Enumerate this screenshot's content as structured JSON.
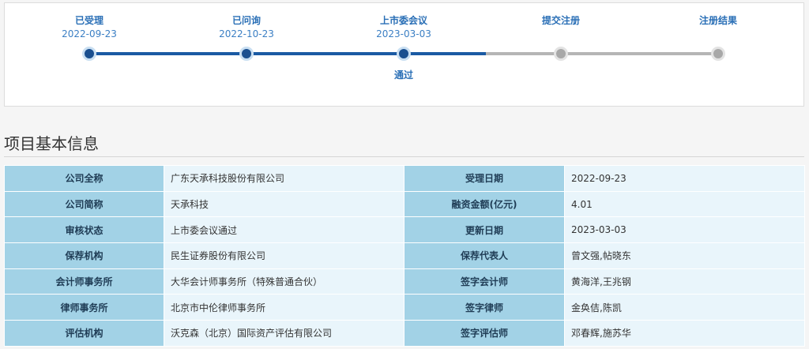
{
  "progress": {
    "steps": [
      {
        "label": "已受理",
        "date": "2022-09-23",
        "status": "done"
      },
      {
        "label": "已问询",
        "date": "2022-10-23",
        "status": "done"
      },
      {
        "label": "上市委会议",
        "date": "2023-03-03",
        "status": "done",
        "sub": "通过"
      },
      {
        "label": "提交注册",
        "date": "",
        "status": "pending"
      },
      {
        "label": "注册结果",
        "date": "",
        "status": "pending"
      }
    ]
  },
  "section": {
    "title": "项目基本信息"
  },
  "info_table": {
    "rows": [
      {
        "k1": "公司全称",
        "v1": "广东天承科技股份有限公司",
        "k2": "受理日期",
        "v2": "2022-09-23"
      },
      {
        "k1": "公司简称",
        "v1": "天承科技",
        "k2": "融资金额(亿元)",
        "v2": "4.01"
      },
      {
        "k1": "审核状态",
        "v1": "上市委会议通过",
        "k2": "更新日期",
        "v2": "2023-03-03"
      },
      {
        "k1": "保荐机构",
        "v1": "民生证券股份有限公司",
        "k2": "保荐代表人",
        "v2": "曾文强,帖晓东"
      },
      {
        "k1": "会计师事务所",
        "v1": "大华会计师事务所（特殊普通合伙）",
        "k2": "签字会计师",
        "v2": "黄海洋,王兆钢"
      },
      {
        "k1": "律师事务所",
        "v1": "北京市中伦律师事务所",
        "k2": "签字律师",
        "v2": "金奂佶,陈凯"
      },
      {
        "k1": "评估机构",
        "v1": "沃克森（北京）国际资产评估有限公司",
        "k2": "签字评估师",
        "v2": "邓春辉,施苏华"
      }
    ]
  },
  "colors": {
    "accent": "#2a6fb6",
    "track_done": "#1a5aa3",
    "track_pending": "#b5b5b5",
    "key_cell_bg": "#a2d2e6",
    "value_cell_bg": "#e9f5fb"
  }
}
